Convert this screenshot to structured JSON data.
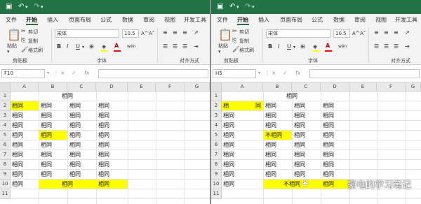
{
  "menu_tabs": [
    "文件",
    "开始",
    "插入",
    "页面布局",
    "公式",
    "数据",
    "审阅",
    "视图",
    "开发工具"
  ],
  "ribbon": {
    "paste": "粘贴",
    "cut": "剪切",
    "copy": "复制",
    "format_painter": "格式刷",
    "clipboard_group": "剪贴板",
    "font_name": "宋体",
    "font_size": "10.5",
    "font_group": "字体",
    "align_group": "对齐方式",
    "bold": "B",
    "italic": "I",
    "underline": "U",
    "font_color_glyph": "A",
    "wen_glyph": "wén",
    "grow_font": "A^",
    "shrink_font": "A˅"
  },
  "formula_icons": {
    "cancel": "×",
    "enter": "✓",
    "fx": "fx"
  },
  "columns": [
    "A",
    "B",
    "C",
    "D",
    "E",
    "F",
    "G"
  ],
  "rows": [
    "1",
    "2",
    "3",
    "4",
    "5",
    "6",
    "7",
    "8",
    "9",
    "10",
    "11"
  ],
  "highlight_color": "#ffff00",
  "left": {
    "namebox": "F10",
    "cells": {
      "r1": "相同",
      "r2": [
        "相同",
        "相同",
        "相同",
        "相同"
      ],
      "r3": [
        "相同",
        "相同",
        "相同",
        "相同"
      ],
      "r4": [
        "相同",
        "相同",
        "相同",
        "相同"
      ],
      "r5": [
        "相同",
        "相同",
        "相同",
        "相同"
      ],
      "r6": [
        "相同",
        "相同",
        "相同",
        "相同"
      ],
      "r7": [
        "相同",
        "相同",
        "相同",
        "相同"
      ],
      "r8": [
        "相同",
        "相同",
        "相同",
        "相同"
      ],
      "r9": [
        "相同",
        "相同",
        "相同",
        "相同"
      ],
      "r10": [
        "相同",
        "相同",
        "相同"
      ]
    }
  },
  "right": {
    "namebox": "H5",
    "cells": {
      "r1": "相同",
      "r2": [
        "相",
        "同",
        "相同",
        "相同",
        "相同"
      ],
      "r3": [
        "相同",
        "相同",
        "相同",
        "相同"
      ],
      "r4": [
        "相同",
        "相同",
        "相同",
        "相同"
      ],
      "r5": [
        "相同",
        "不相同",
        "相同",
        "相同"
      ],
      "r6": [
        "相同",
        "相同",
        "相同",
        "相同"
      ],
      "r7": [
        "相同",
        "相同",
        "相同",
        "相同"
      ],
      "r8": [
        "相同",
        "相同",
        "相同",
        "相同"
      ],
      "r9": [
        "相同",
        "相同",
        "相同",
        "相同"
      ],
      "r10": [
        "相同",
        "不相同",
        "相同"
      ]
    }
  },
  "watermark": "豪电的学习笔记"
}
